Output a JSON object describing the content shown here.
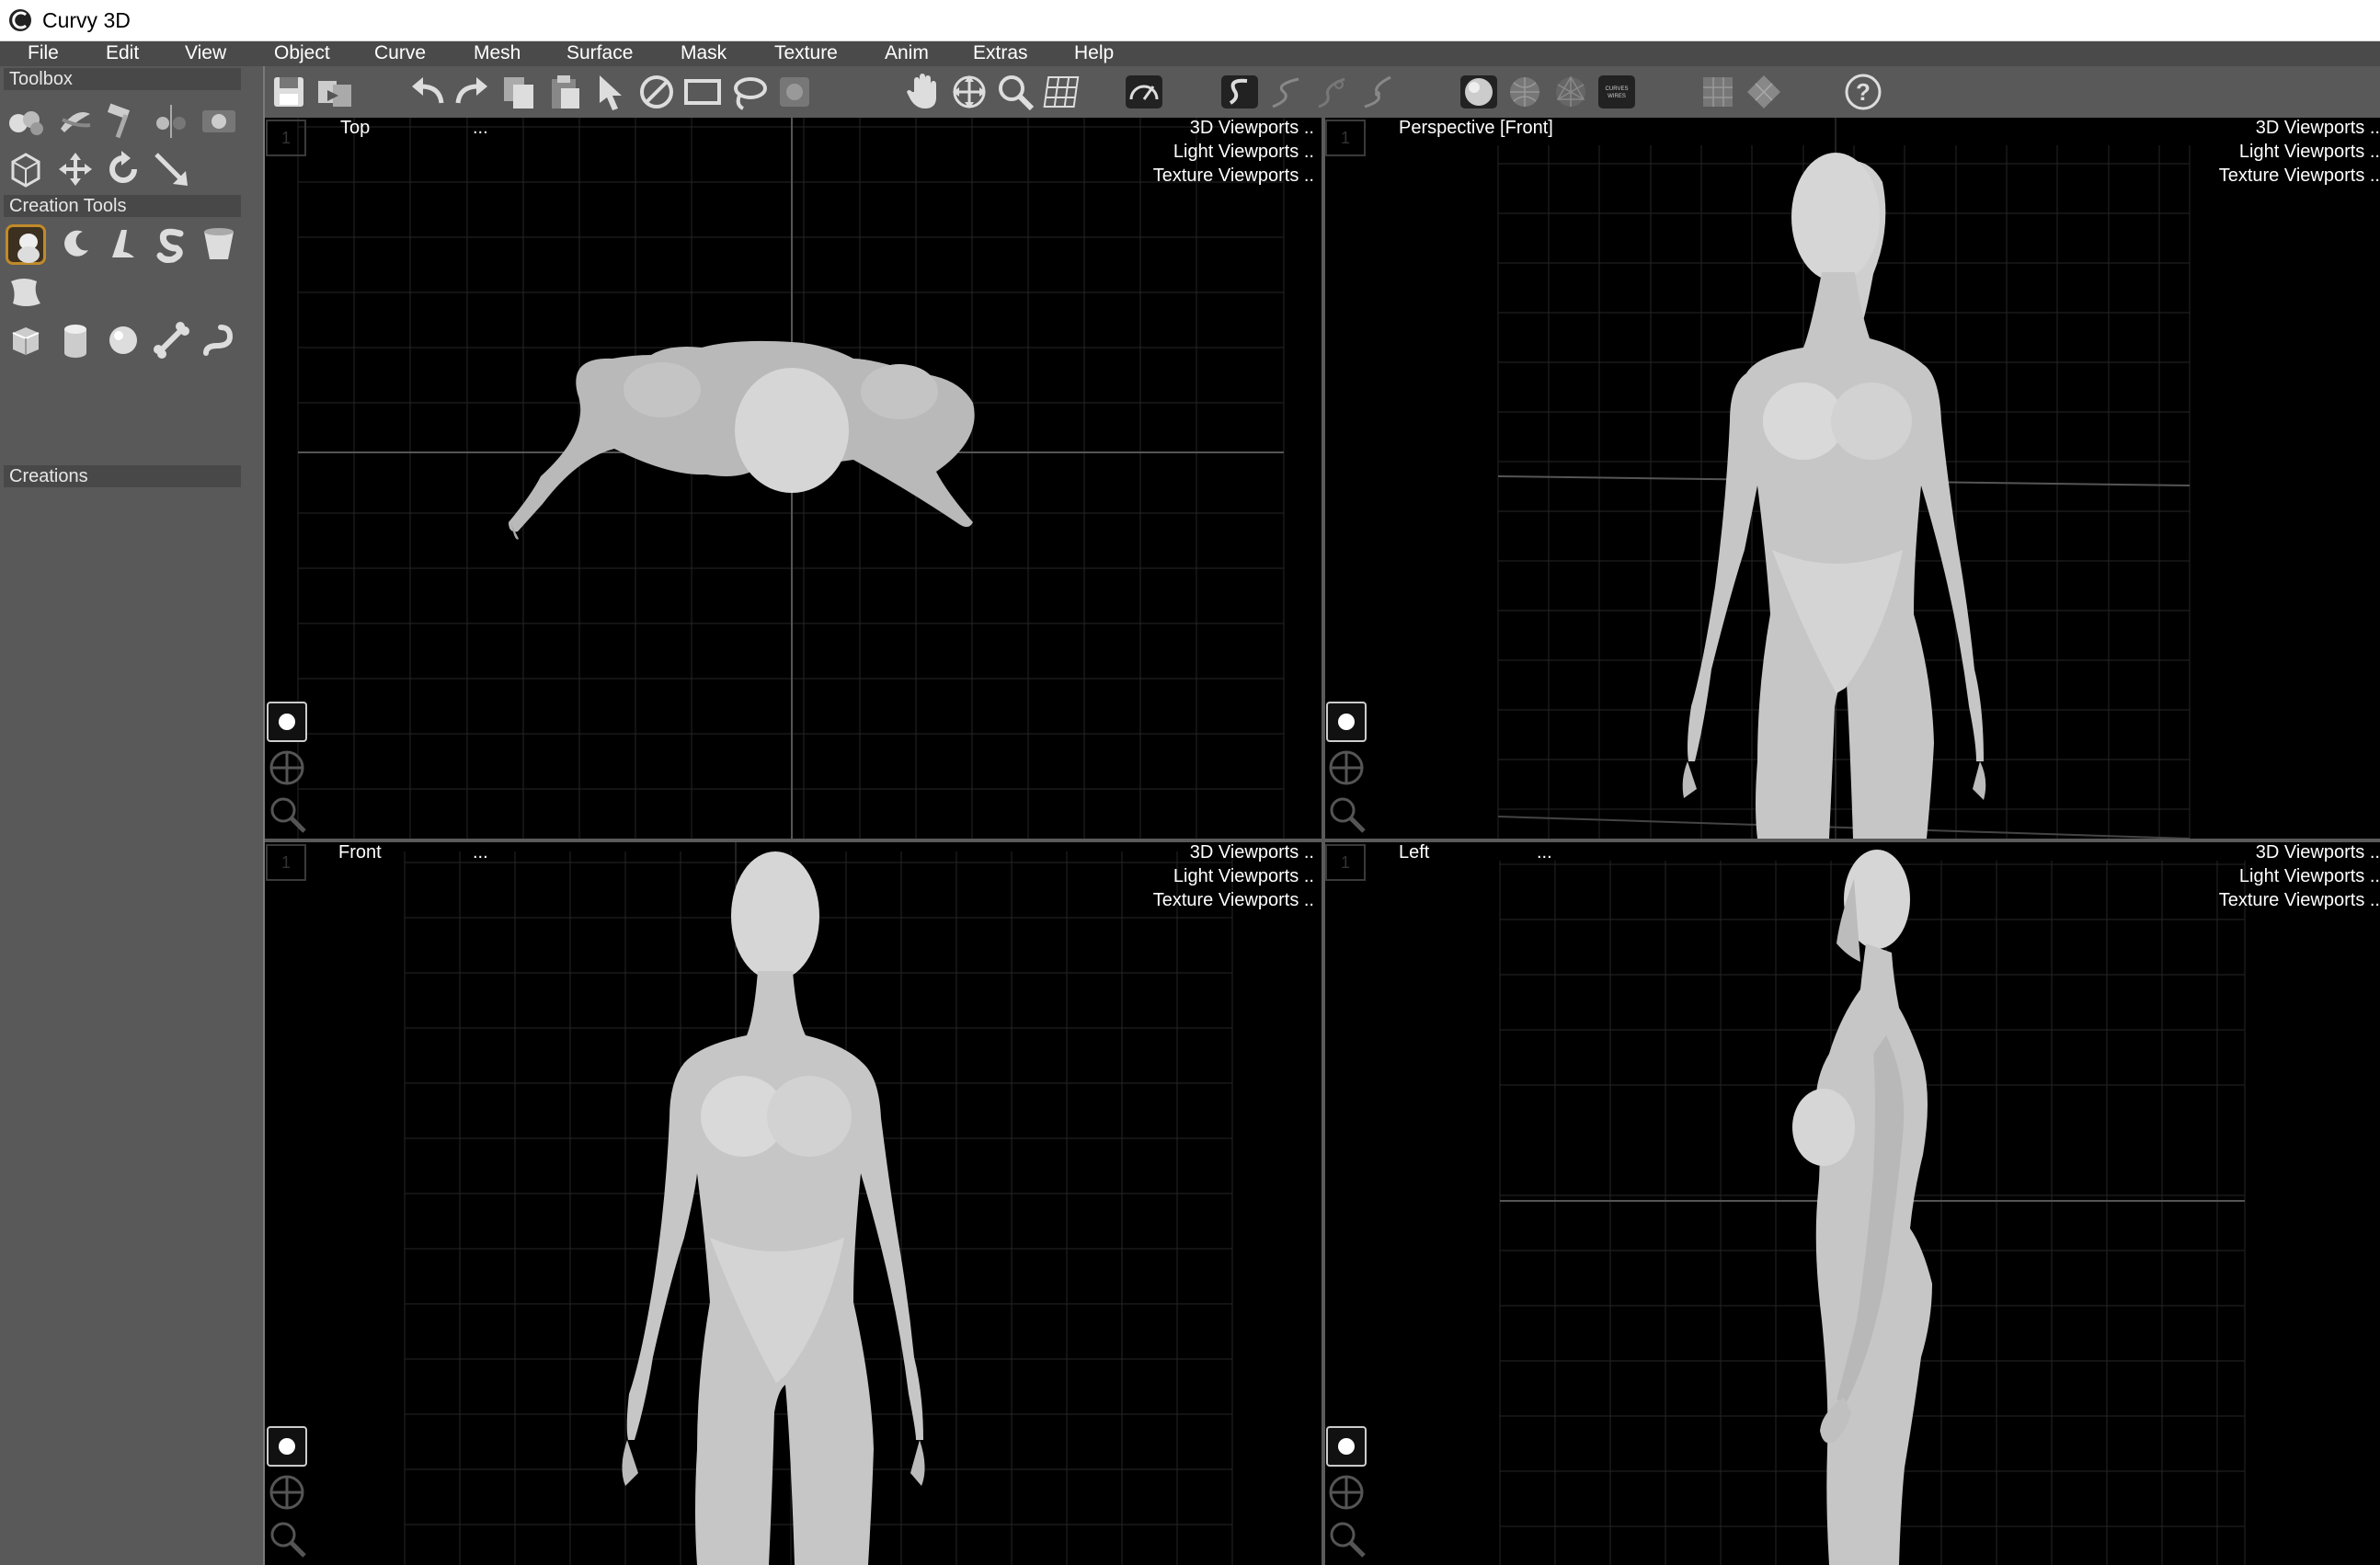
{
  "window": {
    "title": "Curvy 3D"
  },
  "menu": [
    "File",
    "Edit",
    "View",
    "Object",
    "Curve",
    "Mesh",
    "Surface",
    "Mask",
    "Texture",
    "Anim",
    "Extras",
    "Help"
  ],
  "left_panel": {
    "toolbox_label": "Toolbox",
    "creation_tools_label": "Creation Tools",
    "creations_label": "Creations"
  },
  "toolbar_icons": [
    "save-icon",
    "export-icon",
    "undo-icon",
    "redo-icon",
    "copy-icon",
    "paste-icon",
    "select-arrow-icon",
    "no-select-icon",
    "rect-select-icon",
    "lasso-select-icon",
    "mask-select-icon",
    "pan-hand-icon",
    "move-cross-icon",
    "zoom-magnifier-icon",
    "grid-icon",
    "gauge-icon",
    "curve-draw-icon",
    "curve-edit-icon",
    "curve-node-icon",
    "curve-link-icon",
    "shaded-sphere-icon",
    "wire-sphere-icon",
    "wireframe-icon",
    "curves-wires-icon",
    "window-single-icon",
    "window-quad-icon",
    "help-icon"
  ],
  "viewports": {
    "top": {
      "name": "Top",
      "dots": "...",
      "menu": [
        "3D Viewports",
        "Light Viewports",
        "Texture Viewports"
      ],
      "num": "1"
    },
    "perspective": {
      "name": "Perspective [Front]",
      "dots": "...",
      "menu": [
        "3D Viewports",
        "Light Viewports",
        "Texture Viewports"
      ],
      "num": "1"
    },
    "front": {
      "name": "Front",
      "dots": "...",
      "menu": [
        "3D Viewports",
        "Light Viewports",
        "Texture Viewports"
      ],
      "num": "1"
    },
    "left": {
      "name": "Left",
      "dots": "...",
      "menu": [
        "3D Viewports",
        "Light Viewports",
        "Texture Viewports"
      ],
      "num": "1"
    }
  },
  "menu_trailing_dots": "..",
  "colors": {
    "accent_selected": "#c08a2a",
    "panel": "#595959",
    "viewport_bg": "#000000",
    "grid": "#2e2e2e"
  }
}
